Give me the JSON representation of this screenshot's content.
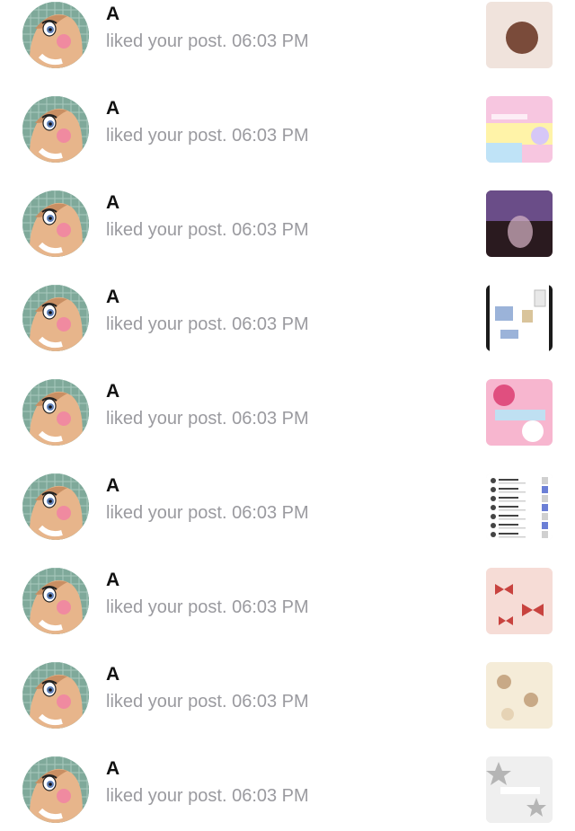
{
  "notifications": [
    {
      "name": "A",
      "action": "liked your post.",
      "time": "06:03 PM",
      "thumb": {
        "kind": "partial",
        "colors": [
          "#7a4b3a",
          "#d9b9a8",
          "#ffffff"
        ]
      }
    },
    {
      "name": "A",
      "action": "liked your post.",
      "time": "06:03 PM",
      "thumb": {
        "kind": "pastel",
        "colors": [
          "#f7c6e0",
          "#fff3a8",
          "#bfe3f7",
          "#d6c7f7"
        ]
      }
    },
    {
      "name": "A",
      "action": "liked your post.",
      "time": "06:03 PM",
      "thumb": {
        "kind": "dark",
        "colors": [
          "#2a1a1f",
          "#7b5aa3",
          "#d8b6c8"
        ]
      }
    },
    {
      "name": "A",
      "action": "liked your post.",
      "time": "06:03 PM",
      "thumb": {
        "kind": "collage",
        "colors": [
          "#ffffff",
          "#9bb3d9",
          "#d9c49b",
          "#1a1a1a"
        ]
      }
    },
    {
      "name": "A",
      "action": "liked your post.",
      "time": "06:03 PM",
      "thumb": {
        "kind": "sticker",
        "colors": [
          "#f7b6cf",
          "#e04f7f",
          "#bfe0f2",
          "#ffffff"
        ]
      }
    },
    {
      "name": "A",
      "action": "liked your post.",
      "time": "06:03 PM",
      "thumb": {
        "kind": "screenshot",
        "colors": [
          "#ffffff",
          "#444444",
          "#d0d0d0",
          "#6b7fd6"
        ]
      }
    },
    {
      "name": "A",
      "action": "liked your post.",
      "time": "06:03 PM",
      "thumb": {
        "kind": "bows",
        "colors": [
          "#f6dcd6",
          "#c8433f",
          "#ffffff"
        ]
      }
    },
    {
      "name": "A",
      "action": "liked your post.",
      "time": "06:03 PM",
      "thumb": {
        "kind": "bears",
        "colors": [
          "#f5ecd8",
          "#c8a986",
          "#e6d3b5"
        ]
      }
    },
    {
      "name": "A",
      "action": "liked your post.",
      "time": "06:03 PM",
      "thumb": {
        "kind": "stars",
        "colors": [
          "#efefef",
          "#b5b5b5",
          "#ffffff"
        ]
      }
    }
  ],
  "colors": {
    "name": "#111111",
    "meta": "#9a9a9f",
    "avatar_bg": "#7fa99a"
  },
  "icons": {
    "avatar": "cartoon-girl-avatar",
    "thumb": "post-thumbnail"
  }
}
